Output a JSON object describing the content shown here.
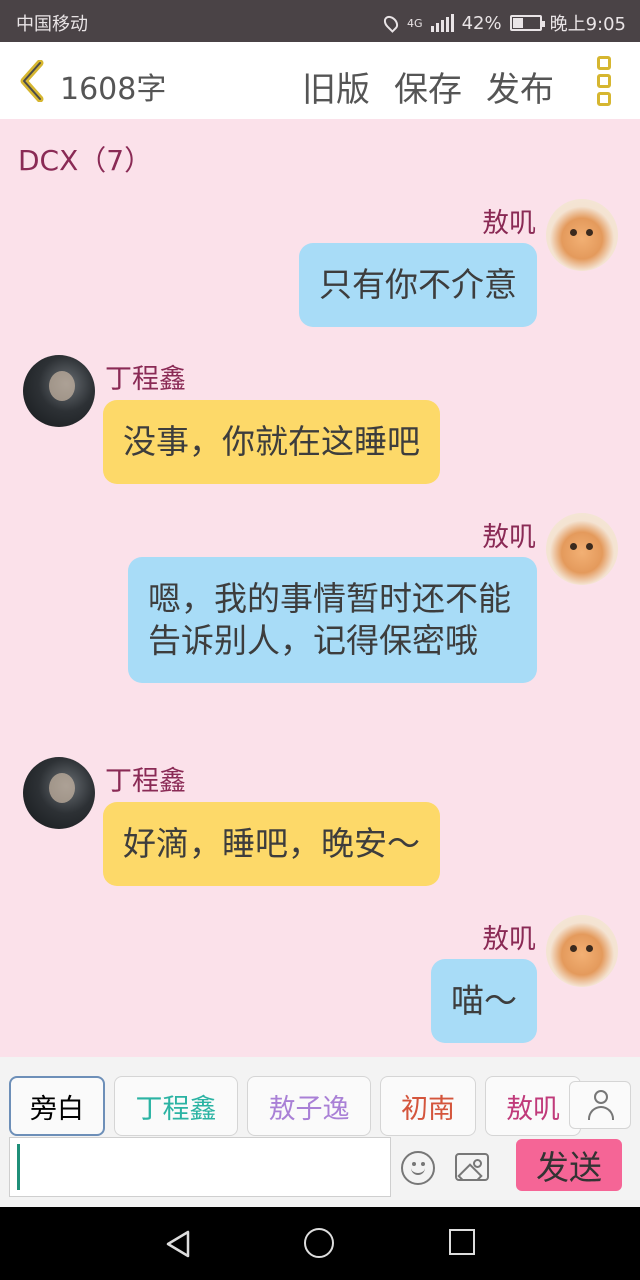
{
  "status_bar": {
    "carrier": "中国移动",
    "network": "4G",
    "battery": "42%",
    "battery_level": 0.42,
    "time": "晚上9:05"
  },
  "toolbar": {
    "word_count": "1608字",
    "old_version": "旧版",
    "save": "保存",
    "publish": "发布",
    "accent": "#d6b630"
  },
  "chat": {
    "title": "DCX（7）",
    "messages": [
      {
        "side": "right",
        "name": "敖叽",
        "text": "只有你不介意",
        "avatar": "cat-avatar"
      },
      {
        "side": "left",
        "name": "丁程鑫",
        "text": "没事，你就在这睡吧",
        "avatar": "boy-avatar"
      },
      {
        "side": "right",
        "name": "敖叽",
        "text": "嗯，我的事情暂时还不能告诉别人，记得保密哦",
        "avatar": "cat-avatar"
      },
      {
        "side": "left",
        "name": "丁程鑫",
        "text": "好滴，睡吧，晚安～",
        "avatar": "boy-avatar"
      },
      {
        "side": "right",
        "name": "敖叽",
        "text": "喵～",
        "avatar": "cat-avatar"
      }
    ]
  },
  "roles": [
    {
      "label": "旁白",
      "color": "#555555"
    },
    {
      "label": "丁程鑫",
      "color": "#2bb3a3"
    },
    {
      "label": "敖子逸",
      "color": "#a980d6"
    },
    {
      "label": "初南",
      "color": "#d4553c"
    },
    {
      "label": "敖叽",
      "color": "#c03a7a"
    }
  ],
  "input": {
    "value": "",
    "send": "发送",
    "send_color": "#f56596"
  },
  "colors": {
    "background": "#fbe1ea",
    "bubble_right": "#a8dcf7",
    "bubble_left": "#fdd969",
    "name_color": "#8a2a55"
  }
}
